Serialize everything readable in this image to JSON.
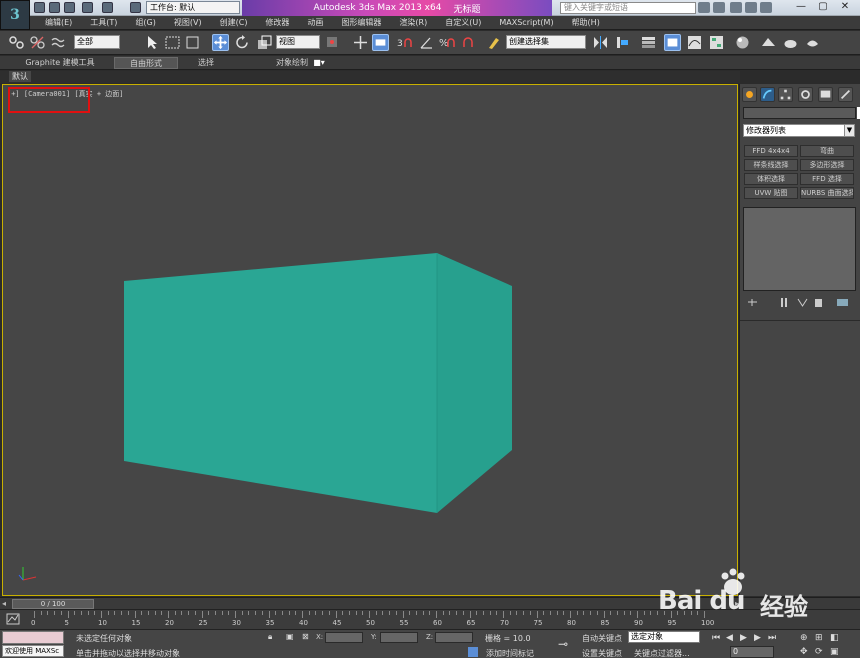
{
  "titlebar": {
    "workspace": "工作台: 默认",
    "app_title": "Autodesk 3ds Max  2013 x64",
    "doc_title": "无标题",
    "search_placeholder": "键入关键字或短语",
    "logo": "3",
    "window_buttons": [
      "—",
      "▢",
      "✕"
    ]
  },
  "menu": [
    "编辑(E)",
    "工具(T)",
    "组(G)",
    "视图(V)",
    "创建(C)",
    "修改器",
    "动画",
    "图形编辑器",
    "渲染(R)",
    "自定义(U)",
    "MAXScript(M)",
    "帮助(H)"
  ],
  "toolbar": {
    "selection_filter": "全部",
    "ref_coord": "视图",
    "named_selection": "创建选择集"
  },
  "ribbon": {
    "tabs": [
      "Graphite 建模工具",
      "自由形式",
      "选择",
      "对象绘制"
    ],
    "default_label": "默认"
  },
  "viewport": {
    "label": "[+] [Camera001] [真实 + 边面]",
    "object_color": "#2aa694",
    "border_color": "#c8b000"
  },
  "command_panel": {
    "modifier_list": "修改器列表",
    "buttons": [
      [
        "FFD 4x4x4",
        "弯曲"
      ],
      [
        "样条线选择",
        "多边形选择"
      ],
      [
        "体积选择",
        "FFD 选择"
      ],
      [
        "UVW 贴图",
        "NURBS 曲面选择"
      ]
    ]
  },
  "timeline": {
    "frame": "0 / 100",
    "ticks": [
      "0",
      "5",
      "10",
      "15",
      "20",
      "25",
      "30",
      "35",
      "40",
      "45",
      "50",
      "55",
      "60",
      "65",
      "70",
      "75",
      "80",
      "85",
      "90",
      "95",
      "100"
    ]
  },
  "status": {
    "welcome": "欢迎使用 MAXSc",
    "selection": "未选定任何对象",
    "prompt": "单击并拖动以选择并移动对象",
    "x_label": "X:",
    "y_label": "Y:",
    "z_label": "Z:",
    "grid": "栅格 = 10.0",
    "add_tag": "添加时间标记",
    "auto_key": "自动关键点",
    "set_key": "设置关键点",
    "selected_object": "选定对象",
    "key_filters": "关键点过滤器...",
    "frame_field": "0"
  },
  "watermark": {
    "brand": "Bai du",
    "text": "经验"
  }
}
